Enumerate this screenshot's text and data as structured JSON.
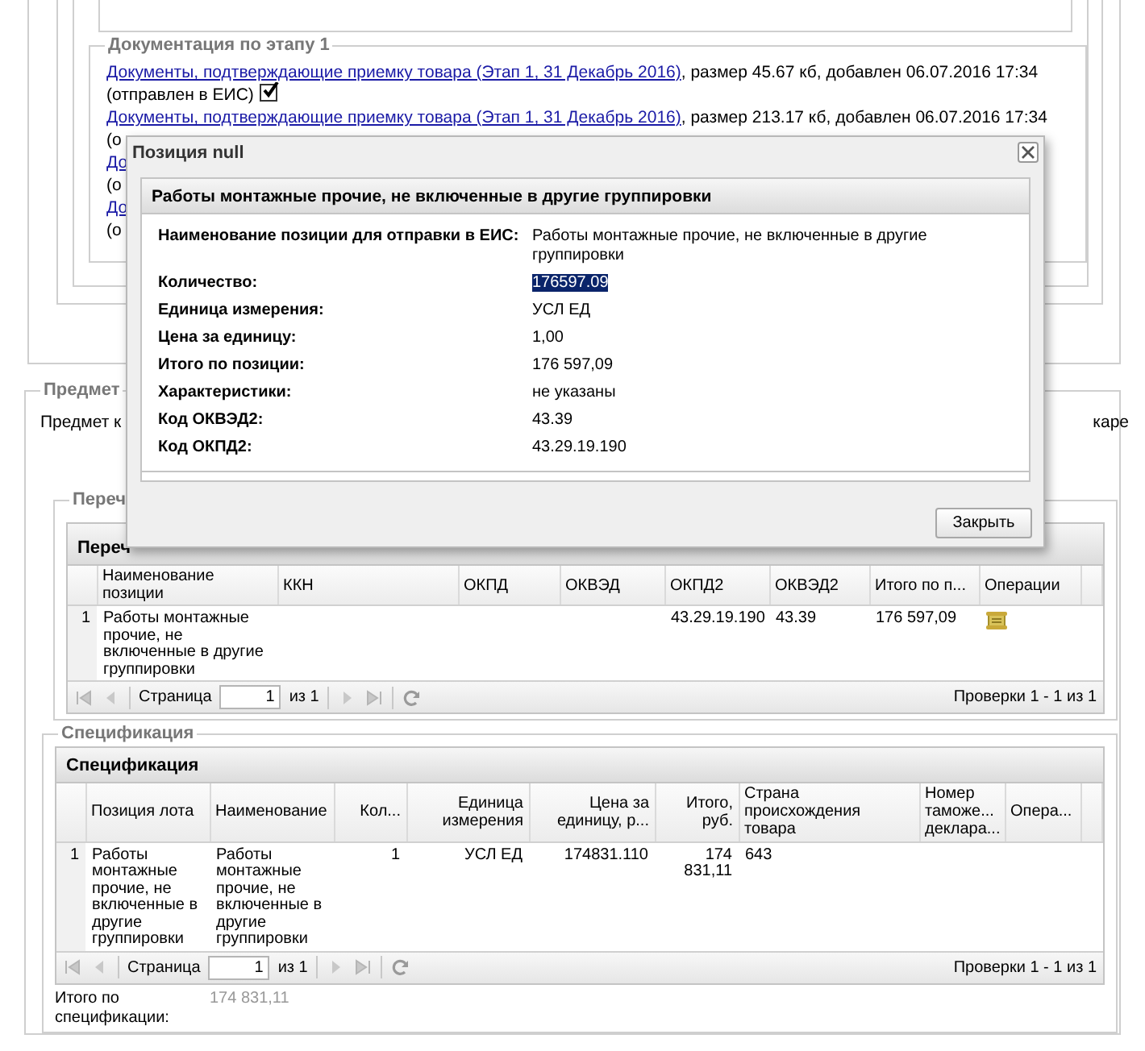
{
  "documentation": {
    "legend": "Документация по этапу 1",
    "items": [
      {
        "link": "Документы, подтверждающие приемку товара (Этап 1, 31 Декабрь 2016)",
        "info": ", размер 45.67 кб, добавлен 06.07.2016 17:34",
        "status": "(отправлен в ЕИС)",
        "checked": true
      },
      {
        "link": "Документы, подтверждающие приемку товара (Этап 1, 31 Декабрь 2016)",
        "info": ", размер 213.17 кб, добавлен 06.07.2016 17:34",
        "status": "(о"
      },
      {
        "link": "До",
        "status": "(о"
      },
      {
        "link": "До",
        "status": "(о"
      }
    ]
  },
  "subject": {
    "legend": "Предмет",
    "text_start": "Предмет к",
    "text_end": "каре"
  },
  "positions": {
    "legend": "Переч",
    "grid": {
      "title": "Переч",
      "columns": [
        {
          "label": "Наименование позиции"
        },
        {
          "label": "ККН"
        },
        {
          "label": "ОКПД"
        },
        {
          "label": "ОКВЭД"
        },
        {
          "label": "ОКПД2"
        },
        {
          "label": "ОКВЭД2"
        },
        {
          "label": "Итого по п..."
        },
        {
          "label": "Операции",
          "kind": "action"
        }
      ],
      "rows": [
        {
          "number": "1",
          "cells": [
            "Работы монтажные прочие, не включенные в другие группировки",
            "",
            "",
            "",
            "43.29.19.190",
            "43.39",
            "176 597,09",
            ""
          ]
        }
      ],
      "pager": {
        "page_label": "Страница",
        "page": "1",
        "of": "из 1",
        "summary": "Проверки 1 - 1 из 1"
      }
    }
  },
  "specification": {
    "legend": "Спецификация",
    "grid": {
      "title": "Спецификация",
      "columns": [
        {
          "label": "Позиция лота"
        },
        {
          "label": "Наименование"
        },
        {
          "label": "Кол..."
        },
        {
          "label": "Единица измерения"
        },
        {
          "label": "Цена за единицу, р..."
        },
        {
          "label": "Итого, руб."
        },
        {
          "label": "Страна происхождения товара"
        },
        {
          "label": "Номер таможе... деклара..."
        },
        {
          "label": "Опера..."
        }
      ],
      "rows": [
        {
          "number": "1",
          "cells": [
            "Работы монтажные прочие, не включенные в другие группировки",
            "Работы монтажные прочие, не включенные в другие группировки",
            "1",
            "УСЛ ЕД",
            "174831.110",
            "174 831,11",
            "643",
            "",
            ""
          ]
        }
      ],
      "pager": {
        "page_label": "Страница",
        "page": "1",
        "of": "из 1",
        "summary": "Проверки 1 - 1 из 1"
      }
    },
    "total_label": "Итого по спецификации:",
    "total": "174 831,11"
  },
  "modal": {
    "title": "Позиция null",
    "heading": "Работы монтажные прочие, не включенные в другие группировки",
    "fields": [
      {
        "label": "Наименование позиции для отправки в ЕИС:",
        "value": "Работы монтажные прочие, не включенные в другие группировки",
        "highlighted": false
      },
      {
        "label": "Количество:",
        "value": "176597.09",
        "highlighted": true
      },
      {
        "label": "Единица измерения:",
        "value": "УСЛ ЕД",
        "highlighted": false
      },
      {
        "label": "Цена за единицу:",
        "value": "1,00",
        "highlighted": false
      },
      {
        "label": "Итого по позиции:",
        "value": "176 597,09",
        "highlighted": false
      },
      {
        "label": "Характеристики:",
        "value": "не указаны",
        "highlighted": false
      },
      {
        "label": "Код ОКВЭД2:",
        "value": "43.39",
        "highlighted": false
      },
      {
        "label": "Код ОКПД2:",
        "value": "43.29.19.190",
        "highlighted": false
      }
    ],
    "button": "Закрыть"
  }
}
